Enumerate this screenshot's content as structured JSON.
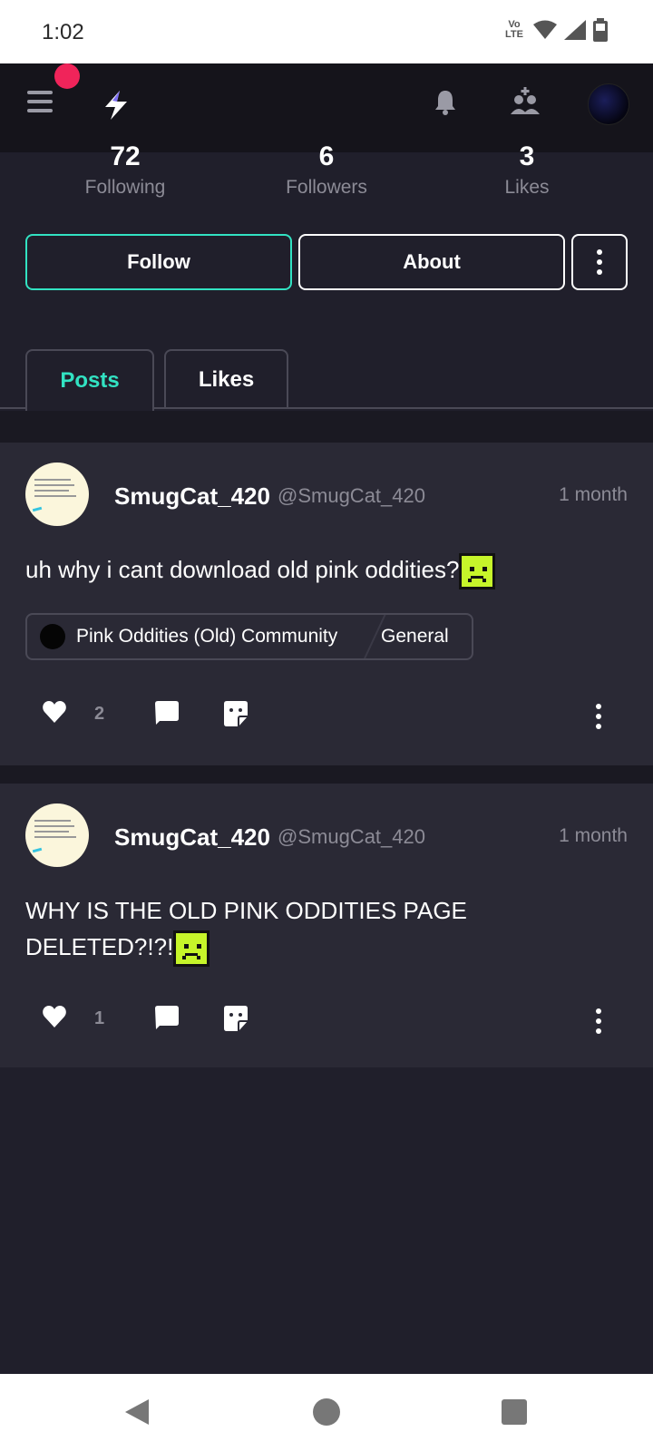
{
  "status_bar": {
    "time": "1:02",
    "network_label": "Vo LTE"
  },
  "header": {
    "menu_icon": "hamburger-menu-icon",
    "logo_icon": "lightning-bolt-logo",
    "notification_icon": "bell-icon",
    "people_icon": "people-icon"
  },
  "stats": [
    {
      "value": "72",
      "label": "Following"
    },
    {
      "value": "6",
      "label": "Followers"
    },
    {
      "value": "3",
      "label": "Likes"
    }
  ],
  "buttons": {
    "follow": "Follow",
    "about": "About"
  },
  "tabs": [
    {
      "label": "Posts",
      "active": true
    },
    {
      "label": "Likes",
      "active": false
    }
  ],
  "posts": [
    {
      "author": "SmugCat_420",
      "handle": "@SmugCat_420",
      "time": "1 month",
      "text": "uh why i cant download old pink oddities?",
      "community": "Pink Oddities (Old) Community",
      "channel": "General",
      "likes": "2"
    },
    {
      "author": "SmugCat_420",
      "handle": "@SmugCat_420",
      "time": "1 month",
      "text_line1": "WHY IS THE OLD PINK ODDITIES PAGE",
      "text_line2": "DELETED?!?!",
      "likes": "1"
    }
  ],
  "colors": {
    "accent": "#32e2c2",
    "background": "#201f2b",
    "card": "#2a2935",
    "notification": "#f0245a",
    "emoji": "#c6f52a"
  }
}
